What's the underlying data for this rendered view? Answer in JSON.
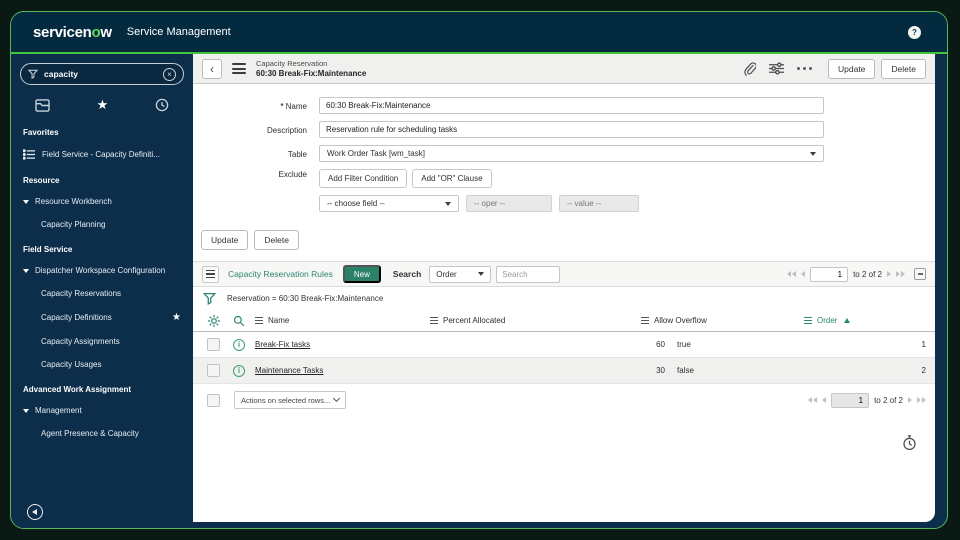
{
  "colors": {
    "accent_green": "#43c33c",
    "teal": "#2e8270",
    "navy": "#0d2e4b",
    "logo_green": "#62d84e"
  },
  "header": {
    "logo_part1": "servicen",
    "logo_green_letter": "o",
    "logo_part2": "w",
    "product": "Service Management",
    "help_label": "?"
  },
  "sidebar": {
    "search_value": "capacity",
    "sections": [
      {
        "label": "Favorites",
        "items": [
          {
            "label": "Field Service - Capacity Definiti..."
          }
        ]
      },
      {
        "label": "Resource",
        "items": [
          {
            "label": "Resource Workbench"
          },
          {
            "label": "Capacity Planning"
          }
        ]
      },
      {
        "label": "Field Service",
        "items": [
          {
            "label": "Dispatcher Workspace Configuration"
          },
          {
            "label": "Capacity Reservations"
          },
          {
            "label": "Capacity Definitions"
          },
          {
            "label": "Capacity Assignments"
          },
          {
            "label": "Capacity Usages"
          }
        ]
      },
      {
        "label": "Advanced Work Assignment",
        "items": [
          {
            "label": "Management"
          },
          {
            "label": "Agent Presence & Capacity"
          }
        ]
      }
    ]
  },
  "record": {
    "type": "Capacity Reservation",
    "name": "60:30 Break-Fix:Maintenance",
    "update_label": "Update",
    "delete_label": "Delete"
  },
  "form": {
    "required_marker": "*",
    "name_label": "Name",
    "name_value": "60:30 Break-Fix:Maintenance",
    "description_label": "Description",
    "description_value": "Reservation rule for scheduling tasks",
    "table_label": "Table",
    "table_value": "Work Order Task [wm_task]",
    "exclude_label": "Exclude",
    "add_filter_label": "Add Filter Condition",
    "add_or_label": "Add \"OR\" Clause",
    "choose_field": "-- choose field --",
    "oper_placeholder": "-- oper --",
    "value_placeholder": "-- value --"
  },
  "list": {
    "title": "Capacity Reservation Rules",
    "new_label": "New",
    "search_label": "Search",
    "search_field": "Order",
    "search_placeholder": "Search",
    "filter_text": "Reservation = 60:30 Break-Fix:Maintenance",
    "columns": {
      "name": "Name",
      "percent": "Percent Allocated",
      "overflow": "Allow Overflow",
      "order": "Order"
    },
    "rows": [
      {
        "name": "Break-Fix tasks",
        "percent": "60",
        "overflow": "true",
        "order": "1"
      },
      {
        "name": "Maintenance Tasks",
        "percent": "30",
        "overflow": "false",
        "order": "2"
      }
    ],
    "pagination": {
      "page": "1",
      "range": "to 2 of 2"
    },
    "actions_label": "Actions on selected rows..."
  }
}
